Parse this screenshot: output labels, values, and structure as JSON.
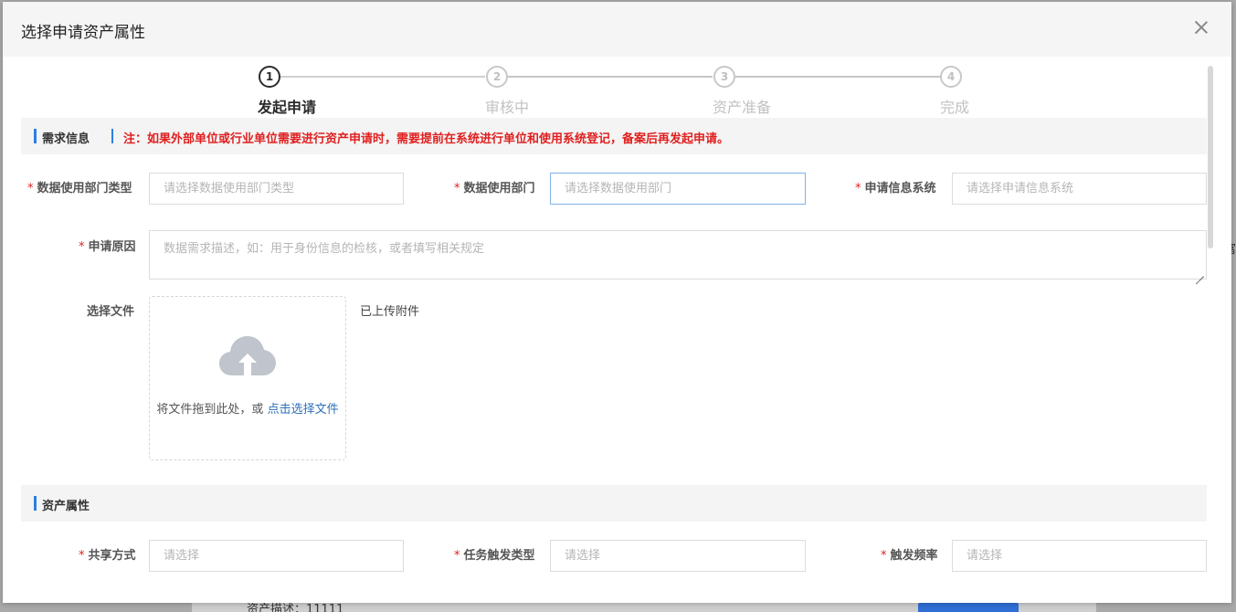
{
  "dialog": {
    "title": "选择申请资产属性"
  },
  "steps": [
    {
      "num": "1",
      "label": "发起申请",
      "active": true
    },
    {
      "num": "2",
      "label": "审核中",
      "active": false
    },
    {
      "num": "3",
      "label": "资产准备",
      "active": false
    },
    {
      "num": "4",
      "label": "完成",
      "active": false
    }
  ],
  "demand": {
    "title": "需求信息",
    "note": "注：如果外部单位或行业单位需要进行资产申请时，需要提前在系统进行单位和使用系统登记，备案后再发起申请。",
    "dept_type_label": "数据使用部门类型",
    "dept_type_placeholder": "请选择数据使用部门类型",
    "dept_label": "数据使用部门",
    "dept_placeholder": "请选择数据使用部门",
    "system_label": "申请信息系统",
    "system_placeholder": "请选择申请信息系统",
    "reason_label": "申请原因",
    "reason_placeholder": "数据需求描述，如：用于身份信息的检核，或者填写相关规定",
    "file_label": "选择文件",
    "upload_text": "将文件拖到此处，或",
    "upload_link": "点击选择文件",
    "uploaded_label": "已上传附件",
    "required_mark": "*"
  },
  "asset": {
    "title": "资产属性",
    "share_label": "共享方式",
    "share_placeholder": "请选择",
    "trigger_type_label": "任务触发类型",
    "trigger_type_placeholder": "请选择",
    "frequency_label": "触发频率",
    "frequency_placeholder": "请选择"
  },
  "backdrop": {
    "text": "资产描述：11111",
    "edge_char": "富"
  },
  "colors": {
    "accent": "#2d7fe0",
    "required": "#e02020",
    "link": "#2d6fb8"
  }
}
